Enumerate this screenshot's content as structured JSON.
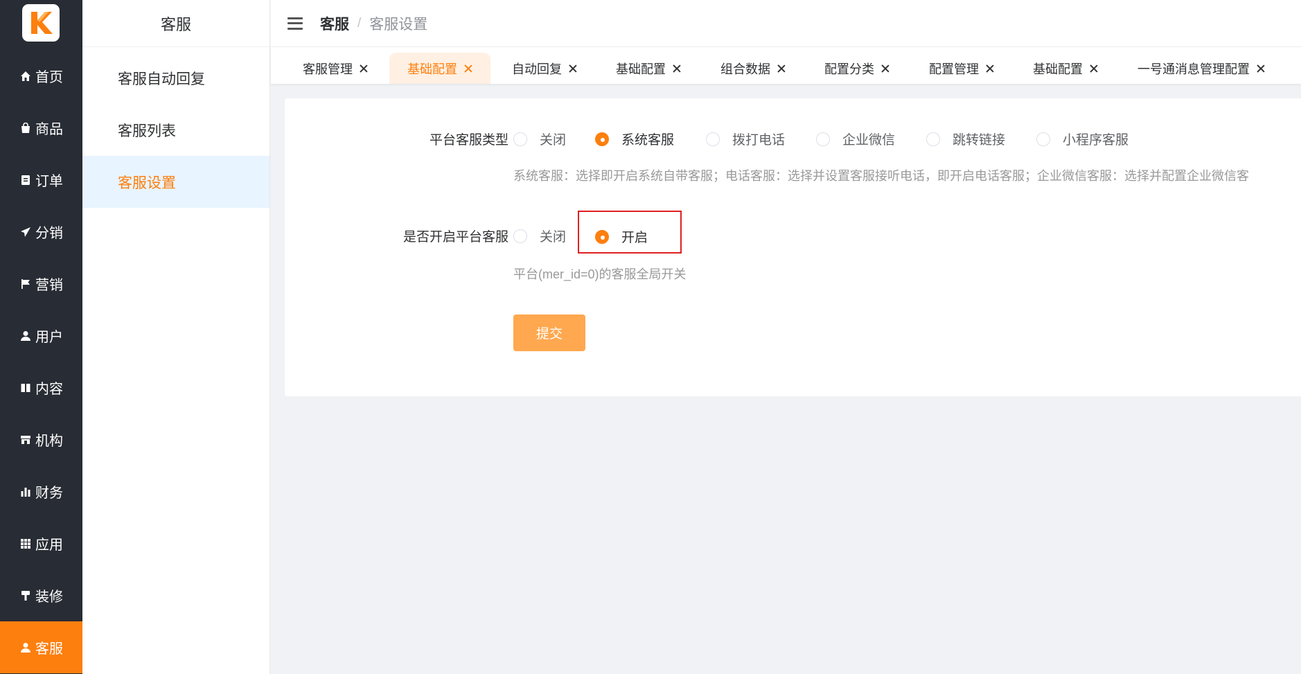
{
  "rail": {
    "items": [
      {
        "label": "首页",
        "icon": "home-icon"
      },
      {
        "label": "商品",
        "icon": "bag-icon"
      },
      {
        "label": "订单",
        "icon": "order-icon"
      },
      {
        "label": "分销",
        "icon": "send-icon"
      },
      {
        "label": "营销",
        "icon": "flag-icon"
      },
      {
        "label": "用户",
        "icon": "user-icon"
      },
      {
        "label": "内容",
        "icon": "book-icon"
      },
      {
        "label": "机构",
        "icon": "store-icon"
      },
      {
        "label": "财务",
        "icon": "bar-chart-icon"
      },
      {
        "label": "应用",
        "icon": "grid-icon"
      },
      {
        "label": "装修",
        "icon": "brush-icon"
      },
      {
        "label": "客服",
        "icon": "user-icon"
      }
    ],
    "active_index": 11,
    "accent_color": "#fd7f0e"
  },
  "submenu": {
    "title": "客服",
    "items": [
      "客服自动回复",
      "客服列表",
      "客服设置"
    ],
    "active_index": 2
  },
  "header": {
    "breadcrumb_root": "客服",
    "breadcrumb_sep": "/",
    "breadcrumb_current": "客服设置"
  },
  "tabs": [
    {
      "label": "客服管理",
      "active": false
    },
    {
      "label": "基础配置",
      "active": true
    },
    {
      "label": "自动回复",
      "active": false
    },
    {
      "label": "基础配置",
      "active": false
    },
    {
      "label": "组合数据",
      "active": false
    },
    {
      "label": "配置分类",
      "active": false
    },
    {
      "label": "配置管理",
      "active": false
    },
    {
      "label": "基础配置",
      "active": false
    },
    {
      "label": "一号通消息管理配置",
      "active": false
    }
  ],
  "form": {
    "type_label": "平台客服类型",
    "type_options": [
      "关闭",
      "系统客服",
      "拨打电话",
      "企业微信",
      "跳转链接",
      "小程序客服"
    ],
    "type_selected": "系统客服",
    "type_hint": "系统客服：选择即开启系统自带客服；电话客服：选择并设置客服接听电话，即开启电话客服；企业微信客服：选择并配置企业微信客",
    "enable_label": "是否开启平台客服",
    "enable_options": [
      "关闭",
      "开启"
    ],
    "enable_selected": "开启",
    "enable_hint": "平台(mer_id=0)的客服全局开关",
    "submit_label": "提交"
  }
}
